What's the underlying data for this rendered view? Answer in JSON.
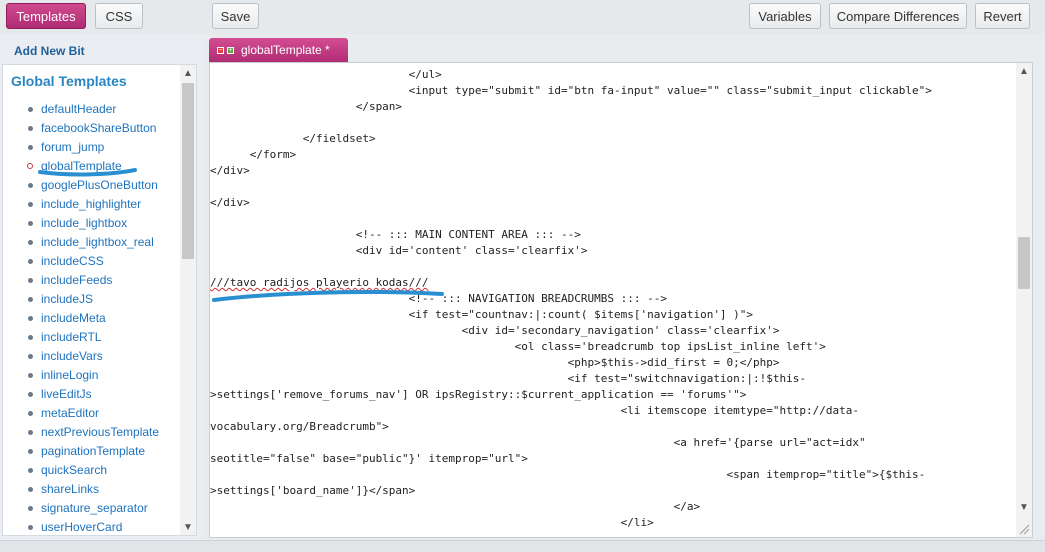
{
  "toolbar": {
    "templates_label": "Templates",
    "css_label": "CSS",
    "save_label": "Save",
    "variables_label": "Variables",
    "compare_label": "Compare Differences",
    "revert_label": "Revert"
  },
  "sidebar": {
    "add_new_bit": "Add New Bit",
    "panel_title": "Global Templates",
    "items": [
      "defaultHeader",
      "facebookShareButton",
      "forum_jump",
      "globalTemplate",
      "googlePlusOneButton",
      "include_highlighter",
      "include_lightbox",
      "include_lightbox_real",
      "includeCSS",
      "includeFeeds",
      "includeJS",
      "includeMeta",
      "includeRTL",
      "includeVars",
      "inlineLogin",
      "liveEditJs",
      "metaEditor",
      "nextPreviousTemplate",
      "paginationTemplate",
      "quickSearch",
      "shareLinks",
      "signature_separator",
      "userHoverCard"
    ],
    "active_item": "globalTemplate"
  },
  "editor": {
    "tab_label": "globalTemplate *",
    "lines": [
      "                              </ul>",
      "                              <input type=\"submit\" id=\"btn fa-input\" value=\"\" class=\"submit_input clickable\">",
      "                      </span>",
      "",
      "              </fieldset>",
      "      </form>",
      "</div>",
      "",
      "</div>",
      "",
      "                      <!-- ::: MAIN CONTENT AREA ::: -->",
      "                      <div id='content' class='clearfix'>",
      "",
      "///tavo radijos playerio kodas///",
      "                              <!-- ::: NAVIGATION BREADCRUMBS ::: -->",
      "                              <if test=\"countnav:|:count( $items['navigation'] )\">",
      "                                      <div id='secondary_navigation' class='clearfix'>",
      "                                              <ol class='breadcrumb top ipsList_inline left'>",
      "                                                      <php>$this->did_first = 0;</php>",
      "                                                      <if test=\"switchnavigation:|:!$this-",
      ">settings['remove_forums_nav'] OR ipsRegistry::$current_application == 'forums'\">",
      "                                                              <li itemscope itemtype=\"http://data-",
      "vocabulary.org/Breadcrumb\">",
      "                                                                      <a href='{parse url=\"act=idx\"",
      "seotitle=\"false\" base=\"public\"}' itemprop=\"url\">",
      "                                                                              <span itemprop=\"title\">{$this-",
      ">settings['board_name']}</span>",
      "                                                                      </a>",
      "                                                              </li>"
    ]
  },
  "colors": {
    "accent": "#c0397f",
    "link": "#1e73be",
    "panel_title": "#2a86c2",
    "annotation": "#2a8fd0"
  }
}
